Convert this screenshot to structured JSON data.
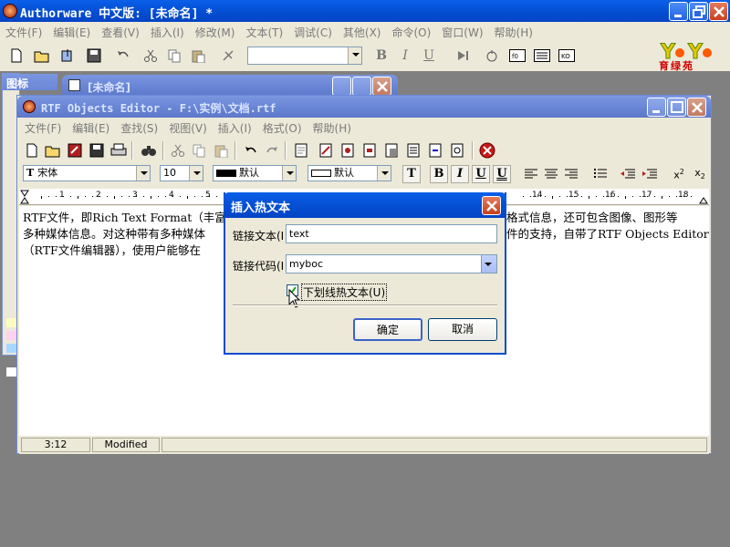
{
  "authorware": {
    "title": "Authorware 中文版: [未命名] *",
    "menu": [
      "文件(F)",
      "编辑(E)",
      "查看(V)",
      "插入(I)",
      "修改(M)",
      "文本(T)",
      "调试(C)",
      "其他(X)",
      "命令(O)",
      "窗口(W)",
      "帮助(H)"
    ],
    "toolbar_labels": {
      "bold": "B",
      "italic": "I",
      "underline": "U"
    },
    "logo_text": "育绿苑",
    "icon_palette_title": "图标",
    "design_window_title": "[未命名]"
  },
  "rtf": {
    "title": "RTF Objects Editor - F:\\实例\\文档.rtf",
    "menu": [
      "文件(F)",
      "编辑(E)",
      "查找(S)",
      "视图(V)",
      "插入(I)",
      "格式(O)",
      "帮助(H)"
    ],
    "font_name": "宋体",
    "font_size": "10",
    "text_color": "默认",
    "back_color": "默认",
    "ruler_numbers": [
      "1",
      "2",
      "3",
      "4",
      "5",
      "14",
      "15",
      "16",
      "17",
      "18"
    ],
    "doc_lines": [
      {
        "left": "RTF文件，即Rich Text Format（丰富",
        "right": "格式信息，还可包含图像、图形等"
      },
      {
        "left": "多种媒体信息。对这种带有多种媒体",
        "right": "件的支持，自带了RTF Objects Editor"
      },
      {
        "left": "（RTF文件编辑器），使用户能够在",
        "right": ""
      }
    ],
    "status_position": "3:12",
    "status_modified": "Modified"
  },
  "dialog": {
    "title": "插入热文本",
    "link_text_label": "链接文本(I",
    "link_text_value": "text",
    "link_code_label": "链接代码(I",
    "link_code_value": "myboc",
    "underline_checkbox_label": "下划线热文本(U)",
    "underline_checked": true,
    "ok_label": "确定",
    "cancel_label": "取消"
  },
  "colors": {
    "xp_blue": "#0551d6",
    "face": "#ece9d8",
    "close_red": "#c8401f"
  }
}
